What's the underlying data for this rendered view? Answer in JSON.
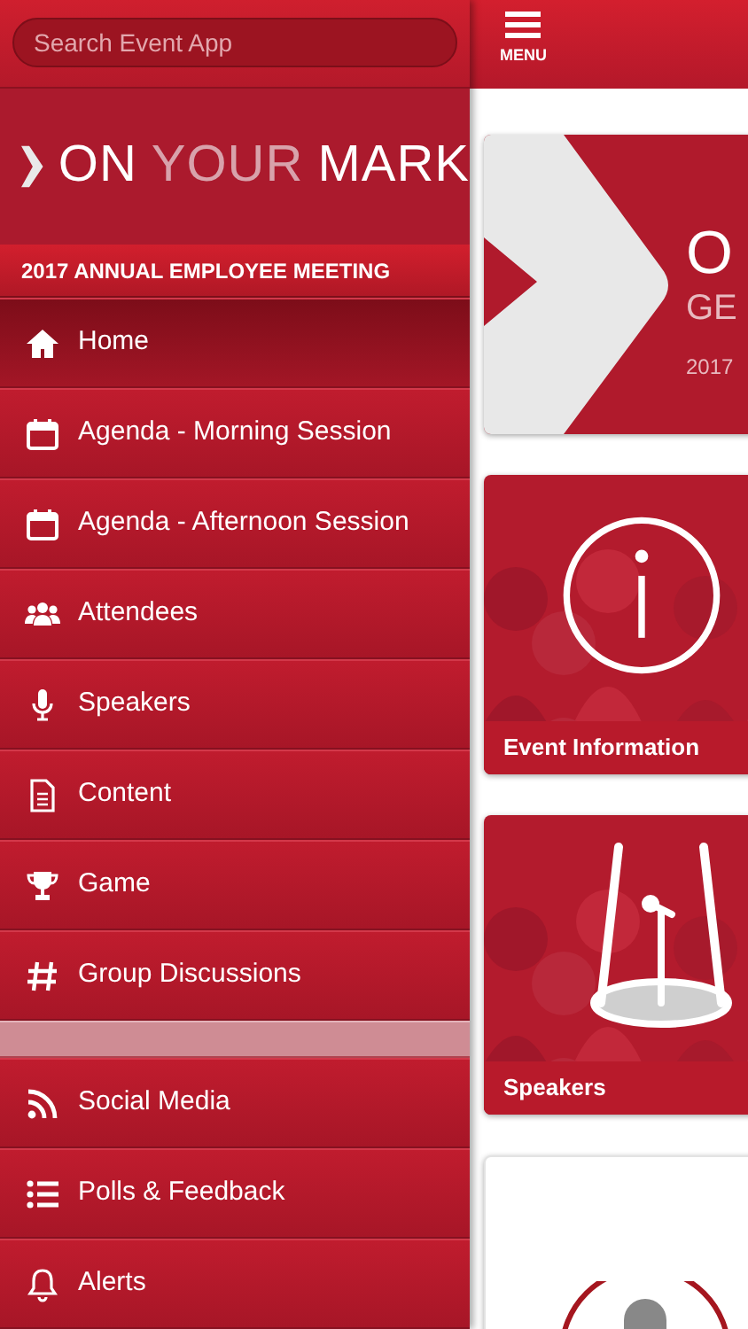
{
  "sidebar": {
    "search": {
      "placeholder": "Search Event App"
    },
    "logo": {
      "parts": [
        {
          "text": "ON",
          "dim": false
        },
        {
          "text": "YOUR",
          "dim": true
        },
        {
          "text": "MARK",
          "dim": false
        }
      ]
    },
    "subtitle": "2017 ANNUAL EMPLOYEE MEETING",
    "items": [
      {
        "kind": "link",
        "label": "Home",
        "selected": true
      },
      {
        "kind": "link",
        "label": "Agenda - Morning Session",
        "selected": false
      },
      {
        "kind": "link",
        "label": "Agenda - Afternoon Session",
        "selected": false
      },
      {
        "kind": "link",
        "label": "Attendees",
        "selected": false
      },
      {
        "kind": "link",
        "label": "Speakers",
        "selected": false
      },
      {
        "kind": "link",
        "label": "Content",
        "selected": false
      },
      {
        "kind": "link",
        "label": "Game",
        "selected": false
      },
      {
        "kind": "link",
        "label": "Group Discussions",
        "selected": false
      },
      {
        "kind": "spacer"
      },
      {
        "kind": "link",
        "label": "Social Media",
        "selected": false
      },
      {
        "kind": "link",
        "label": "Polls & Feedback",
        "selected": false
      },
      {
        "kind": "link",
        "label": "Alerts",
        "selected": false
      }
    ]
  },
  "header": {
    "menu_label": "MENU"
  },
  "tiles": [
    {
      "kind": "banner",
      "title": "O",
      "subtitle": "GE",
      "year": "2017"
    },
    {
      "label": "Event Information"
    },
    {
      "label": "Speakers"
    },
    {
      "kind": "plain"
    }
  ]
}
